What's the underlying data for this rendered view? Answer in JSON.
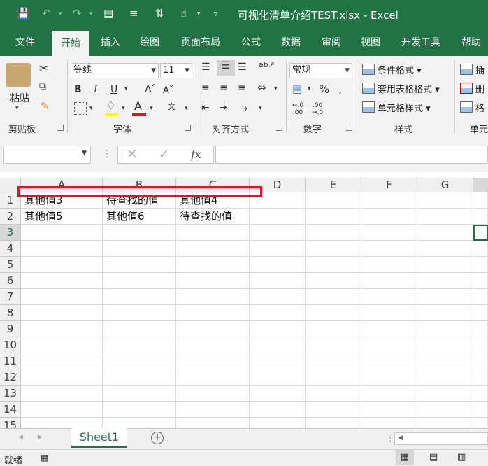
{
  "window": {
    "title": "可视化清单介绍TEST.xlsx  -  Excel"
  },
  "ribbon_tabs": [
    "文件",
    "开始",
    "插入",
    "绘图",
    "页面布局",
    "公式",
    "数据",
    "审阅",
    "视图",
    "开发工具",
    "帮助"
  ],
  "ribbon": {
    "clipboard": {
      "paste_label": "粘贴",
      "group_label": "剪贴板"
    },
    "font": {
      "font_name": "等线",
      "font_size": "11",
      "group_label": "字体"
    },
    "alignment": {
      "group_label": "对齐方式"
    },
    "number": {
      "format": "常规",
      "group_label": "数字"
    },
    "styles": {
      "conditional": "条件格式",
      "table": "套用表格格式",
      "cell": "单元格样式",
      "group_label": "样式"
    },
    "cells": {
      "insert": "插",
      "delete": "删",
      "format": "格",
      "group_label": "单元"
    }
  },
  "formula_bar": {
    "name_box": "",
    "formula": ""
  },
  "columns": [
    "A",
    "B",
    "C",
    "D",
    "E",
    "F",
    "G"
  ],
  "rows": [
    "1",
    "2",
    "3",
    "4",
    "5",
    "6",
    "7",
    "8",
    "9",
    "10",
    "11",
    "12",
    "13",
    "14",
    "15"
  ],
  "cells": {
    "A1": "其他值3",
    "B1": "待查找的值",
    "C1": "其他值4",
    "A2": "其他值5",
    "B2": "其他值6",
    "C2": "待查找的值"
  },
  "sheet_tabs": [
    "Sheet1"
  ],
  "status": {
    "ready": "就绪"
  },
  "colors": {
    "excel_green": "#217346",
    "highlight_red": "#e81123",
    "font_color": "#e81123",
    "fill_color": "#ffff00"
  }
}
